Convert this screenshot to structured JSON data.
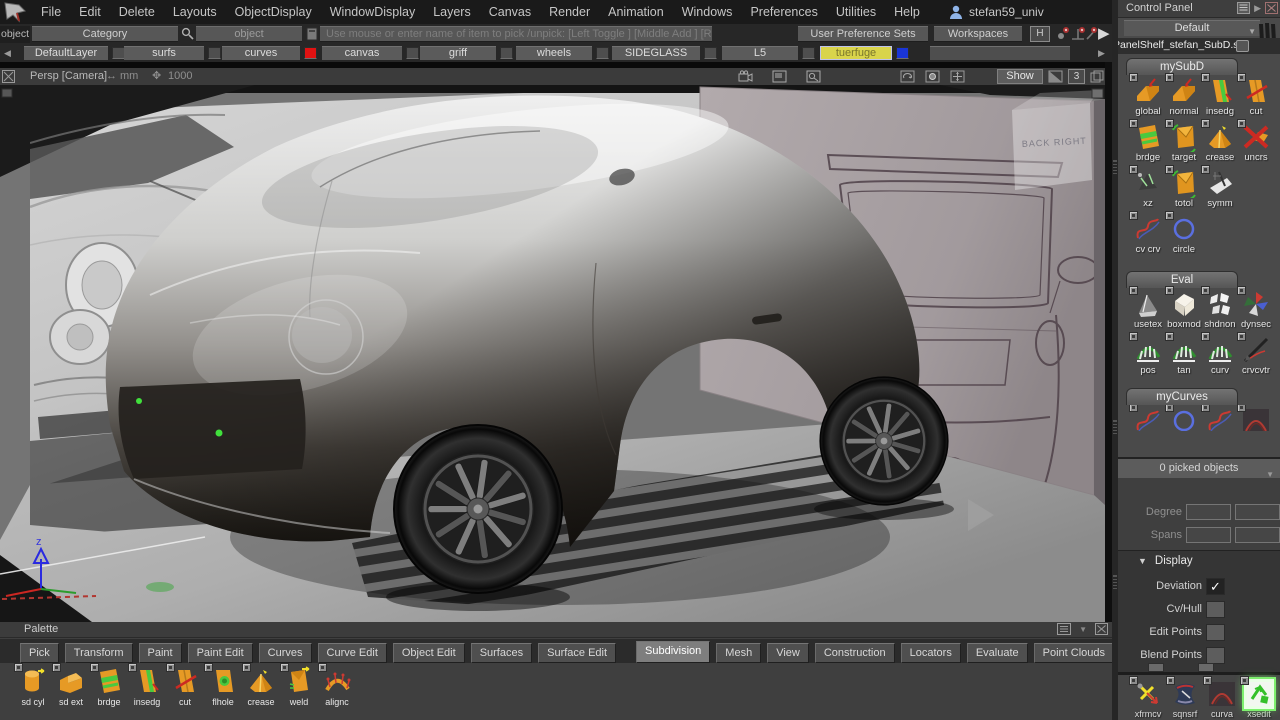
{
  "app": {
    "user": "stefan59_univ"
  },
  "menu": {
    "items": [
      "File",
      "Edit",
      "Delete",
      "Layouts",
      "ObjectDisplay",
      "WindowDisplay",
      "Layers",
      "Canvas",
      "Render",
      "Animation",
      "Windows",
      "Preferences",
      "Utilities",
      "Help"
    ]
  },
  "pick_bar": {
    "object_button": "object",
    "category_field": "Category",
    "object_field": "object",
    "prompt": "Use mouse or enter name of item to pick /unpick:  [Left Toggle ] [Middle Add ] [Right Unpick ]",
    "user_preference_sets": "User Preference Sets",
    "workspaces": "Workspaces",
    "history_badge": "H"
  },
  "layer_bar": {
    "layers": [
      {
        "name": "DefaultLayer",
        "swatch": null,
        "selected": false
      },
      {
        "name": "surfs",
        "swatch": null,
        "selected": false
      },
      {
        "name": "curves",
        "swatch": "#e01212",
        "selected": false
      },
      {
        "name": "canvas",
        "swatch": null,
        "selected": false
      },
      {
        "name": "griff",
        "swatch": null,
        "selected": false
      },
      {
        "name": "wheels",
        "swatch": null,
        "selected": false
      },
      {
        "name": "SIDEGLASS",
        "swatch": null,
        "selected": false
      },
      {
        "name": "L5",
        "swatch": null,
        "selected": false
      },
      {
        "name": "tuerfuge",
        "swatch": "#1a35d6",
        "selected": true
      }
    ]
  },
  "viewport": {
    "camera_label": "Persp [Camera]",
    "units_label": "mm",
    "grid_size": "1000",
    "show_button": "Show",
    "pane_count": "3",
    "backlight_card_label": "BACK RIGHT",
    "axis_z_label": "z"
  },
  "palette": {
    "title": "Palette",
    "tabs": [
      {
        "label": "Pick",
        "active": false
      },
      {
        "label": "Transform",
        "active": false
      },
      {
        "label": "Paint",
        "active": false
      },
      {
        "label": "Paint Edit",
        "active": false
      },
      {
        "label": "Curves",
        "active": false
      },
      {
        "label": "Curve Edit",
        "active": false
      },
      {
        "label": "Object Edit",
        "active": false
      },
      {
        "label": "Surfaces",
        "active": false
      },
      {
        "label": "Surface Edit",
        "active": false
      },
      {
        "label": "Subdivision",
        "active": true
      },
      {
        "label": "Mesh",
        "active": false
      },
      {
        "label": "View",
        "active": false
      },
      {
        "label": "Construction",
        "active": false
      },
      {
        "label": "Locators",
        "active": false
      },
      {
        "label": "Evaluate",
        "active": false
      },
      {
        "label": "Point Clouds",
        "active": false
      }
    ],
    "tools": [
      {
        "label": "sd cyl"
      },
      {
        "label": "sd ext"
      },
      {
        "label": "brdge"
      },
      {
        "label": "insedg"
      },
      {
        "label": "cut"
      },
      {
        "label": "flhole"
      },
      {
        "label": "crease"
      },
      {
        "label": "weld"
      },
      {
        "label": "alignc"
      }
    ]
  },
  "control_panel": {
    "title": "Control Panel",
    "preset": "Default",
    "shelf_file": "PanelShelf_stefan_SubD.stn",
    "shelves": [
      {
        "title": "mySubD",
        "rows": [
          [
            {
              "label": "global"
            },
            {
              "label": "normal"
            },
            {
              "label": "insedg"
            },
            {
              "label": "cut"
            }
          ],
          [
            {
              "label": "brdge"
            },
            {
              "label": "target"
            },
            {
              "label": "crease"
            },
            {
              "label": "uncrs"
            }
          ],
          [
            {
              "label": "xz"
            },
            {
              "label": "totol"
            },
            {
              "label": "symm"
            }
          ],
          [
            {
              "label": "cv crv"
            },
            {
              "label": "circle"
            }
          ]
        ]
      },
      {
        "title": "Eval",
        "rows": [
          [
            {
              "label": "usetex"
            },
            {
              "label": "boxmod"
            },
            {
              "label": "shdnon"
            },
            {
              "label": "dynsec"
            }
          ],
          [
            {
              "label": "pos"
            },
            {
              "label": "tan"
            },
            {
              "label": "curv"
            },
            {
              "label": "crvcvtr"
            }
          ]
        ]
      },
      {
        "title": "myCurves",
        "rows": []
      }
    ],
    "picked_status": "0 picked objects",
    "properties": {
      "degree_label": "Degree",
      "spans_label": "Spans"
    },
    "display": {
      "title": "Display",
      "items": [
        {
          "label": "Deviation",
          "checked": true
        },
        {
          "label": "Cv/Hull",
          "checked": false
        },
        {
          "label": "Edit Points",
          "checked": false
        },
        {
          "label": "Blend Points",
          "checked": false
        }
      ]
    },
    "bottom_shelf": [
      {
        "label": "xfrmcv",
        "active": false
      },
      {
        "label": "sqnsrf",
        "active": false
      },
      {
        "label": "curva",
        "active": false
      },
      {
        "label": "xsedit",
        "active": true
      }
    ]
  },
  "colors": {
    "icon_orange": "#e69a25",
    "layer_red": "#e01212",
    "layer_blue": "#1a35d6",
    "selected_layer_yellow": "#d9d44b",
    "highlight_green": "#35c02a",
    "user_icon_blue": "#8fb4e8"
  }
}
